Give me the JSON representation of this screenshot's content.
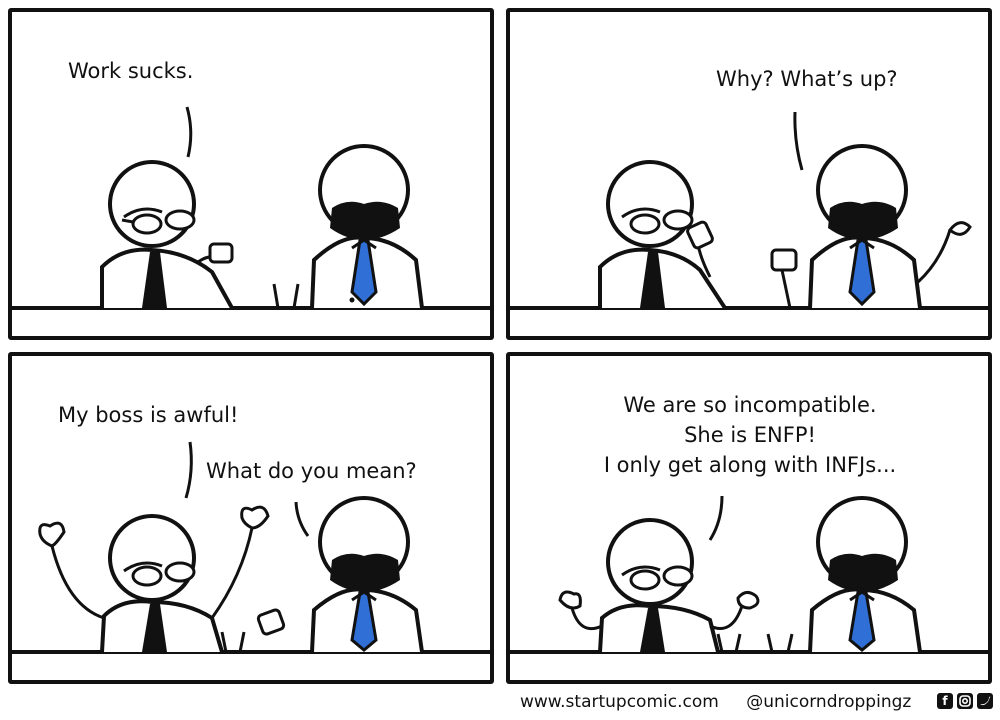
{
  "panels": [
    {
      "lines": [
        "Work sucks."
      ]
    },
    {
      "lines": [
        "Why? What’s up?"
      ]
    },
    {
      "lines": [
        "My boss is awful!",
        "What do you mean?"
      ]
    },
    {
      "lines": [
        "We are so incompatible.",
        "She is ENFP!",
        "I only get along with INFJs..."
      ]
    }
  ],
  "footer": {
    "url": "www.startupcomic.com",
    "handle": "@unicorndroppingz"
  },
  "social_icons": [
    "facebook-icon",
    "instagram-icon",
    "twitter-icon"
  ],
  "colors": {
    "ink": "#111111",
    "tie_blue": "#2f6fd6"
  }
}
